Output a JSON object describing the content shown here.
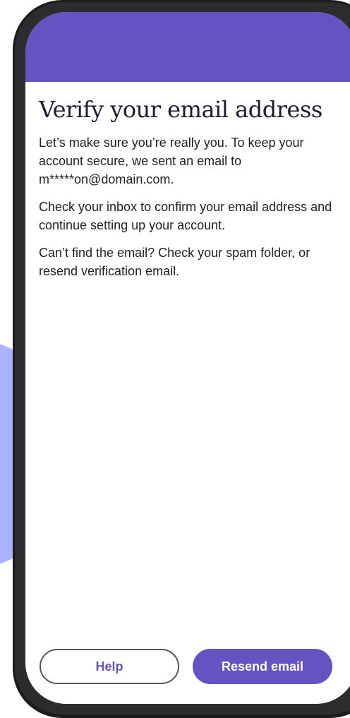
{
  "screen": {
    "title": "Verify your email address",
    "paragraphs": [
      "Let’s make sure you’re really you.  To keep your account secure, we sent an email to m*****on@domain.com.",
      "Check your inbox to confirm your email address and continue setting up your account.",
      "Can’t find the email? Check your spam folder, or resend verification email."
    ]
  },
  "buttons": {
    "help_label": "Help",
    "resend_label": "Resend email"
  },
  "colors": {
    "accent": "#6752c2",
    "background_blob": "#a9b2fb",
    "phone_frame": "#1c1c1e"
  }
}
